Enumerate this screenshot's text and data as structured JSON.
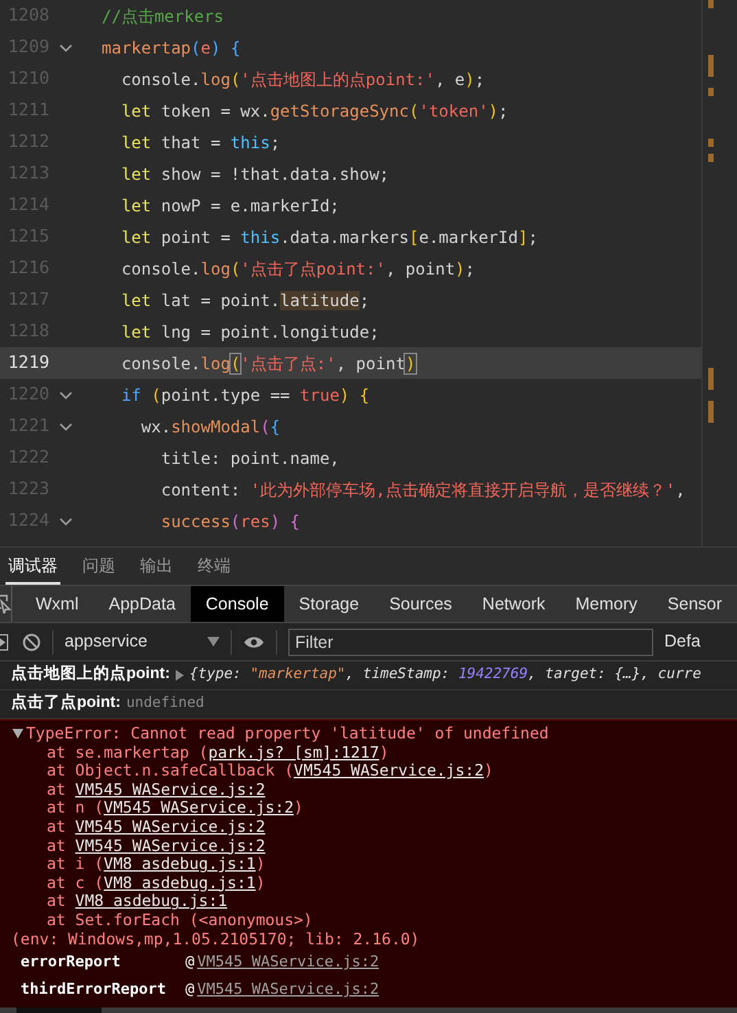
{
  "editor": {
    "lines": [
      {
        "number": "1208",
        "fold": false,
        "current": false,
        "tokens": [
          {
            "text": "//点击merkers",
            "kind": "comment"
          }
        ]
      },
      {
        "number": "1209",
        "fold": true,
        "current": false,
        "tokens": [
          {
            "text": "markertap",
            "kind": "fn"
          },
          {
            "text": "(",
            "kind": "brace"
          },
          {
            "text": "e",
            "kind": "param"
          },
          {
            "text": ") {",
            "kind": "brace"
          }
        ]
      },
      {
        "number": "1210",
        "fold": false,
        "current": false,
        "tokens": [
          {
            "text": "  console.",
            "kind": "plain"
          },
          {
            "text": "log",
            "kind": "fn"
          },
          {
            "text": "(",
            "kind": "paren"
          },
          {
            "text": "'点击地图上的点point:'",
            "kind": "str"
          },
          {
            "text": ", e",
            "kind": "plain"
          },
          {
            "text": ")",
            "kind": "paren"
          },
          {
            "text": ";",
            "kind": "plain"
          }
        ]
      },
      {
        "number": "1211",
        "fold": false,
        "current": false,
        "tokens": [
          {
            "text": "  let",
            "kind": "kw"
          },
          {
            "text": " token = wx.",
            "kind": "plain"
          },
          {
            "text": "getStorageSync",
            "kind": "fn"
          },
          {
            "text": "(",
            "kind": "paren"
          },
          {
            "text": "'token'",
            "kind": "str"
          },
          {
            "text": ")",
            "kind": "paren"
          },
          {
            "text": ";",
            "kind": "plain"
          }
        ]
      },
      {
        "number": "1212",
        "fold": false,
        "current": false,
        "tokens": [
          {
            "text": "  let",
            "kind": "kw"
          },
          {
            "text": " that = ",
            "kind": "plain"
          },
          {
            "text": "this",
            "kind": "this"
          },
          {
            "text": ";",
            "kind": "plain"
          }
        ]
      },
      {
        "number": "1213",
        "fold": false,
        "current": false,
        "tokens": [
          {
            "text": "  let",
            "kind": "kw"
          },
          {
            "text": " show = !that.data.show;",
            "kind": "plain"
          }
        ]
      },
      {
        "number": "1214",
        "fold": false,
        "current": false,
        "tokens": [
          {
            "text": "  let",
            "kind": "kw"
          },
          {
            "text": " nowP = e.markerId;",
            "kind": "plain"
          }
        ]
      },
      {
        "number": "1215",
        "fold": false,
        "current": false,
        "tokens": [
          {
            "text": "  let",
            "kind": "kw"
          },
          {
            "text": " point = ",
            "kind": "plain"
          },
          {
            "text": "this",
            "kind": "this"
          },
          {
            "text": ".data.markers",
            "kind": "plain"
          },
          {
            "text": "[",
            "kind": "paren"
          },
          {
            "text": "e.markerId",
            "kind": "plain"
          },
          {
            "text": "]",
            "kind": "paren"
          },
          {
            "text": ";",
            "kind": "plain"
          }
        ]
      },
      {
        "number": "1216",
        "fold": false,
        "current": false,
        "tokens": [
          {
            "text": "  console.",
            "kind": "plain"
          },
          {
            "text": "log",
            "kind": "fn"
          },
          {
            "text": "(",
            "kind": "paren"
          },
          {
            "text": "'点击了点point:'",
            "kind": "str"
          },
          {
            "text": ", point",
            "kind": "plain"
          },
          {
            "text": ")",
            "kind": "paren"
          },
          {
            "text": ";",
            "kind": "plain"
          }
        ]
      },
      {
        "number": "1217",
        "fold": false,
        "current": false,
        "tokens": [
          {
            "text": "  let",
            "kind": "kw"
          },
          {
            "text": " lat = point.",
            "kind": "plain"
          },
          {
            "text": "latitude",
            "kind": "match"
          },
          {
            "text": ";",
            "kind": "plain"
          }
        ]
      },
      {
        "number": "1218",
        "fold": false,
        "current": false,
        "tokens": [
          {
            "text": "  let",
            "kind": "kw"
          },
          {
            "text": " lng = point.longitude;",
            "kind": "plain"
          }
        ]
      },
      {
        "number": "1219",
        "fold": false,
        "current": true,
        "tokens": [
          {
            "text": "  console.",
            "kind": "plain"
          },
          {
            "text": "log",
            "kind": "fn"
          },
          {
            "text": "(",
            "kind": "bracketmatch"
          },
          {
            "text": "'点击了点:'",
            "kind": "str"
          },
          {
            "text": ", point",
            "kind": "plain"
          },
          {
            "text": ")",
            "kind": "bracketmatch"
          }
        ]
      },
      {
        "number": "1220",
        "fold": true,
        "current": false,
        "tokens": [
          {
            "text": "  if",
            "kind": "kw2"
          },
          {
            "text": " (",
            "kind": "paren"
          },
          {
            "text": "point.type == ",
            "kind": "plain"
          },
          {
            "text": "true",
            "kind": "bool"
          },
          {
            "text": ")",
            "kind": "paren"
          },
          {
            "text": " {",
            "kind": "paren"
          }
        ]
      },
      {
        "number": "1221",
        "fold": true,
        "current": false,
        "tokens": [
          {
            "text": "    wx.",
            "kind": "plain"
          },
          {
            "text": "showModal",
            "kind": "fn"
          },
          {
            "text": "(",
            "kind": "brace2"
          },
          {
            "text": "{",
            "kind": "brace"
          }
        ]
      },
      {
        "number": "1222",
        "fold": false,
        "current": false,
        "tokens": [
          {
            "text": "      title: point.name,",
            "kind": "plain"
          }
        ]
      },
      {
        "number": "1223",
        "fold": false,
        "current": false,
        "tokens": [
          {
            "text": "      content: ",
            "kind": "plain"
          },
          {
            "text": "'此为外部停车场,点击确定将直接开启导航，是否继续？'",
            "kind": "str"
          },
          {
            "text": ",",
            "kind": "plain"
          }
        ]
      },
      {
        "number": "1224",
        "fold": true,
        "current": false,
        "tokens": [
          {
            "text": "      success",
            "kind": "fn"
          },
          {
            "text": "(",
            "kind": "brace2"
          },
          {
            "text": "res",
            "kind": "param"
          },
          {
            "text": ") {",
            "kind": "brace2"
          }
        ]
      }
    ]
  },
  "panel_tabs": [
    {
      "label": "调试器",
      "selected": true
    },
    {
      "label": "问题",
      "selected": false
    },
    {
      "label": "输出",
      "selected": false
    },
    {
      "label": "终端",
      "selected": false
    }
  ],
  "devtools_tabs": [
    {
      "label": "Wxml",
      "selected": false
    },
    {
      "label": "AppData",
      "selected": false
    },
    {
      "label": "Console",
      "selected": true
    },
    {
      "label": "Storage",
      "selected": false
    },
    {
      "label": "Sources",
      "selected": false
    },
    {
      "label": "Network",
      "selected": false
    },
    {
      "label": "Memory",
      "selected": false
    },
    {
      "label": "Sensor",
      "selected": false
    }
  ],
  "toolbar": {
    "context": "appservice",
    "filter_placeholder": "Filter",
    "levels": "Defa"
  },
  "messages": [
    {
      "label": "点击地图上的点point:",
      "expandable": true,
      "tokens": [
        {
          "text": "{type: ",
          "kind": "key"
        },
        {
          "text": "\"markertap\"",
          "kind": "str"
        },
        {
          "text": ", timeStamp: ",
          "kind": "key"
        },
        {
          "text": "19422769",
          "kind": "num"
        },
        {
          "text": ", target: {…}, curre",
          "kind": "key"
        }
      ]
    },
    {
      "label": "点击了点point:",
      "expandable": false,
      "tokens": [
        {
          "text": "undefined",
          "kind": "undef"
        }
      ]
    }
  ],
  "error": {
    "expanded": true,
    "message": "TypeError: Cannot read property 'latitude' of undefined",
    "stack": [
      {
        "prefix": "at se.markertap (",
        "link": "park.js? [sm]:1217",
        "suffix": ")"
      },
      {
        "prefix": "at Object.n.safeCallback (",
        "link": "VM545 WAService.js:2",
        "suffix": ")"
      },
      {
        "prefix": "at ",
        "link": "VM545 WAService.js:2"
      },
      {
        "prefix": "at n (",
        "link": "VM545 WAService.js:2",
        "suffix": ")"
      },
      {
        "prefix": "at ",
        "link": "VM545 WAService.js:2"
      },
      {
        "prefix": "at ",
        "link": "VM545 WAService.js:2"
      },
      {
        "prefix": "at i (",
        "link": "VM8 asdebug.js:1",
        "suffix": ")"
      },
      {
        "prefix": "at c (",
        "link": "VM8 asdebug.js:1",
        "suffix": ")"
      },
      {
        "prefix": "at ",
        "link": "VM8 asdebug.js:1"
      },
      {
        "prefix": "at Set.forEach (<anonymous>)"
      }
    ],
    "env": "(env: Windows,mp,1.05.2105170; lib: 2.16.0)",
    "reports": [
      {
        "name": "errorReport",
        "at": "@",
        "link": "VM545 WAService.js:2"
      },
      {
        "name": "thirdErrorReport",
        "at": "@",
        "link": "VM545 WAService.js:2"
      }
    ]
  }
}
